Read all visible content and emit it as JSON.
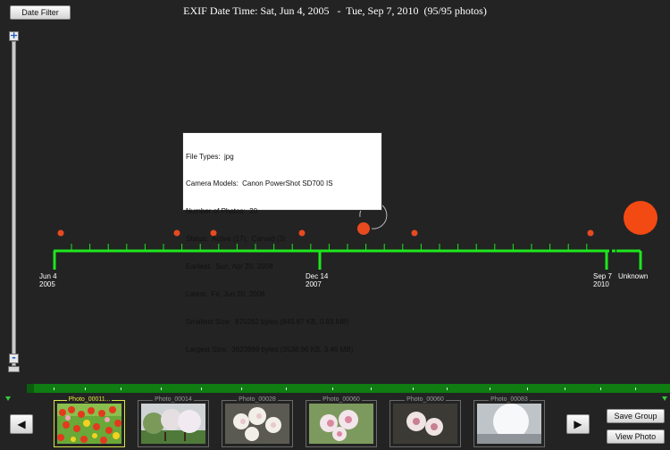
{
  "toolbar": {
    "date_filter_label": "Date Filter"
  },
  "header": {
    "title": "EXIF Date Time: Sat, Jun 4, 2005   -  Tue, Sep 7, 2010  (95/95 photos)"
  },
  "zoom": {
    "plus": "+",
    "minus": "-"
  },
  "timeline": {
    "labels": [
      {
        "line1": "Jun 4",
        "line2": "2005"
      },
      {
        "line1": "Dec 14",
        "line2": "2007"
      },
      {
        "line1": "Sep 7",
        "line2": "2010"
      },
      {
        "line1": "Unknown",
        "line2": ""
      }
    ],
    "colors": {
      "axis": "#1ee61e",
      "marker": "#e84a1f",
      "background": "#232323"
    }
  },
  "tooltip": {
    "lines": [
      "File Types:  jpg",
      "Camera Models:  Canon PowerShot SD700 IS",
      "Number of Photos:  20",
      "Status:  Active (17),  Carved (3)",
      "Earliest:  Sun, Apr 20, 2008",
      "Latest:  Fri, Jun 20, 2008",
      "Smallest Size:  870262 bytes (849.87 KB, 0.83 MB)",
      "Largest Size:  3623899 bytes (3538.96 KB, 3.46 MB)"
    ]
  },
  "filmstrip": {
    "prev_icon": "left-triangle-icon",
    "next_icon": "right-triangle-icon",
    "prev_glyph": "◀",
    "next_glyph": "▶",
    "thumbnails": [
      {
        "label": "Photo_00011...",
        "selected": true,
        "scene": "tulips"
      },
      {
        "label": "Photo_00014",
        "selected": false,
        "scene": "trees"
      },
      {
        "label": "Photo_00028",
        "selected": false,
        "scene": "blossom-white"
      },
      {
        "label": "Photo_00060",
        "selected": false,
        "scene": "blossom-pink"
      },
      {
        "label": "Photo_00060",
        "selected": false,
        "scene": "blossom-dark"
      },
      {
        "label": "Photo_00083",
        "selected": false,
        "scene": "bright-sky"
      }
    ]
  },
  "actions": {
    "save_group_label": "Save Group",
    "view_photo_label": "View Photo"
  }
}
